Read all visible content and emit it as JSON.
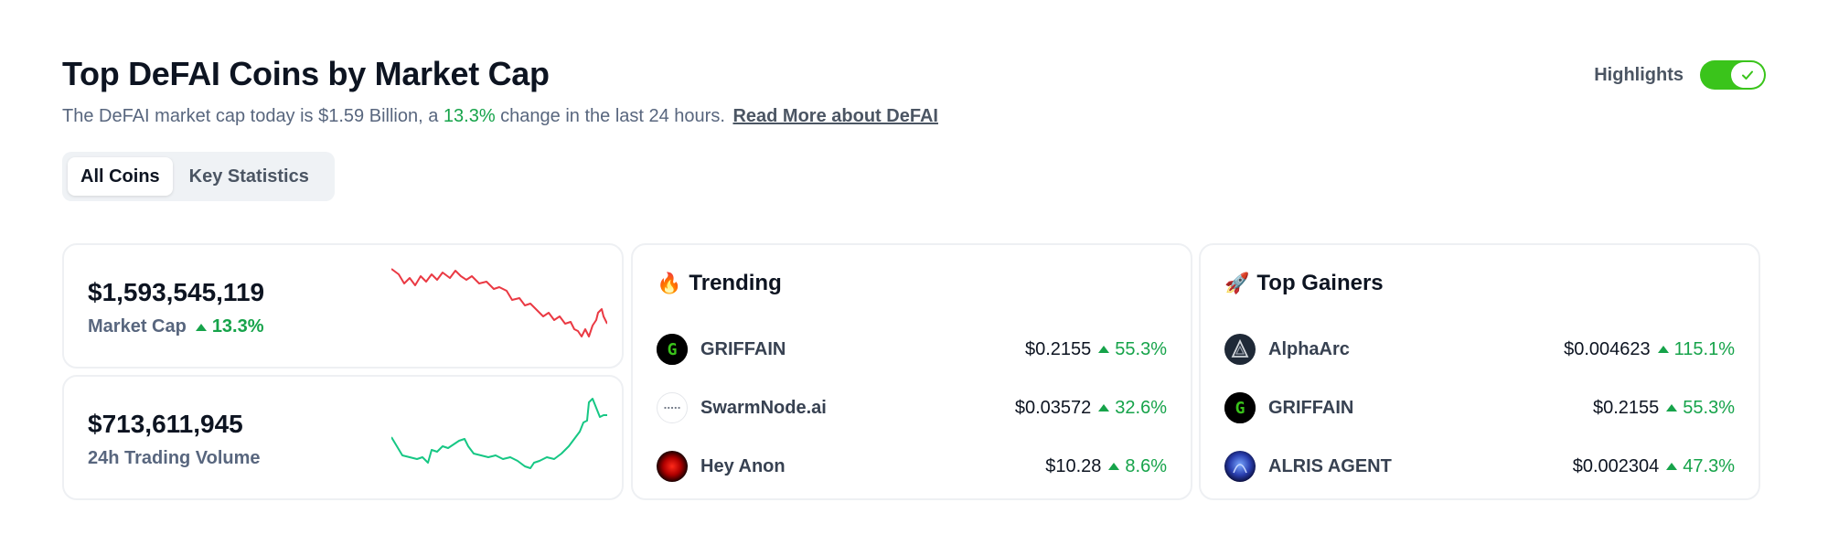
{
  "header": {
    "title": "Top DeFAI Coins by Market Cap",
    "subtitle_prefix": "The DeFAI market cap today is $1.59 Billion, a",
    "subtitle_pct": "13.3%",
    "subtitle_suffix": "change in the last 24 hours.",
    "read_more": "Read More about DeFAI"
  },
  "highlights": {
    "label": "Highlights",
    "enabled": true
  },
  "tabs": [
    {
      "label": "All Coins",
      "active": true
    },
    {
      "label": "Key Statistics",
      "active": false
    }
  ],
  "stats": {
    "market_cap": {
      "value": "$1,593,545,119",
      "label": "Market Cap",
      "change": "13.3%",
      "spark_color": "#ea3943"
    },
    "volume": {
      "value": "$713,611,945",
      "label": "24h Trading Volume",
      "spark_color": "#16c784"
    }
  },
  "trending": {
    "emoji": "🔥",
    "title": "Trending",
    "items": [
      {
        "name": "GRIFFAIN",
        "price": "$0.2155",
        "change": "55.3%",
        "icon": "griffain-icon"
      },
      {
        "name": "SwarmNode.ai",
        "price": "$0.03572",
        "change": "32.6%",
        "icon": "swarmnode-icon"
      },
      {
        "name": "Hey Anon",
        "price": "$10.28",
        "change": "8.6%",
        "icon": "hey-anon-icon"
      }
    ]
  },
  "top_gainers": {
    "emoji": "🚀",
    "title": "Top Gainers",
    "items": [
      {
        "name": "AlphaArc",
        "price": "$0.004623",
        "change": "115.1%",
        "icon": "alphaarc-icon"
      },
      {
        "name": "GRIFFAIN",
        "price": "$0.2155",
        "change": "55.3%",
        "icon": "griffain-icon"
      },
      {
        "name": "ALRIS AGENT",
        "price": "$0.002304",
        "change": "47.3%",
        "icon": "alris-agent-icon"
      }
    ]
  },
  "colors": {
    "positive": "#16a34a",
    "negative": "#ea3943",
    "toggle_on": "#3ac41b"
  }
}
